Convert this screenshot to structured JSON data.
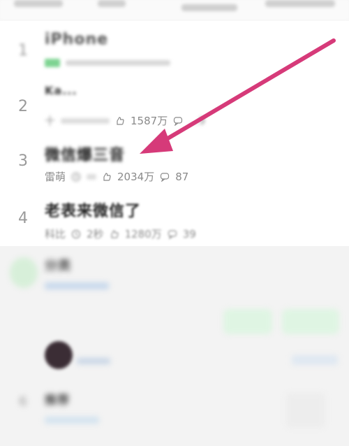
{
  "items": [
    {
      "rank": "1",
      "title": "iPhone",
      "likes": "",
      "comments": ""
    },
    {
      "rank": "2",
      "title": "Ka...",
      "author": "十",
      "likes": "1587万",
      "comments": "...9"
    },
    {
      "rank": "3",
      "title": "微信爆三音",
      "author": "雷萌",
      "likes": "2034万",
      "comments": "87"
    },
    {
      "rank": "4",
      "title": "老表来微信了",
      "author": "科比",
      "time": "2秒",
      "likes": "1280万",
      "comments": "39"
    }
  ],
  "lower": {
    "item5_title": "分类",
    "item6_rank": "6",
    "item6_title": "推荐"
  },
  "colors": {
    "accent_arrow": "#d63a79",
    "green": "#4cc46a"
  },
  "icons": {
    "like": "like-icon",
    "comment": "comment-icon",
    "clock": "clock-icon"
  }
}
